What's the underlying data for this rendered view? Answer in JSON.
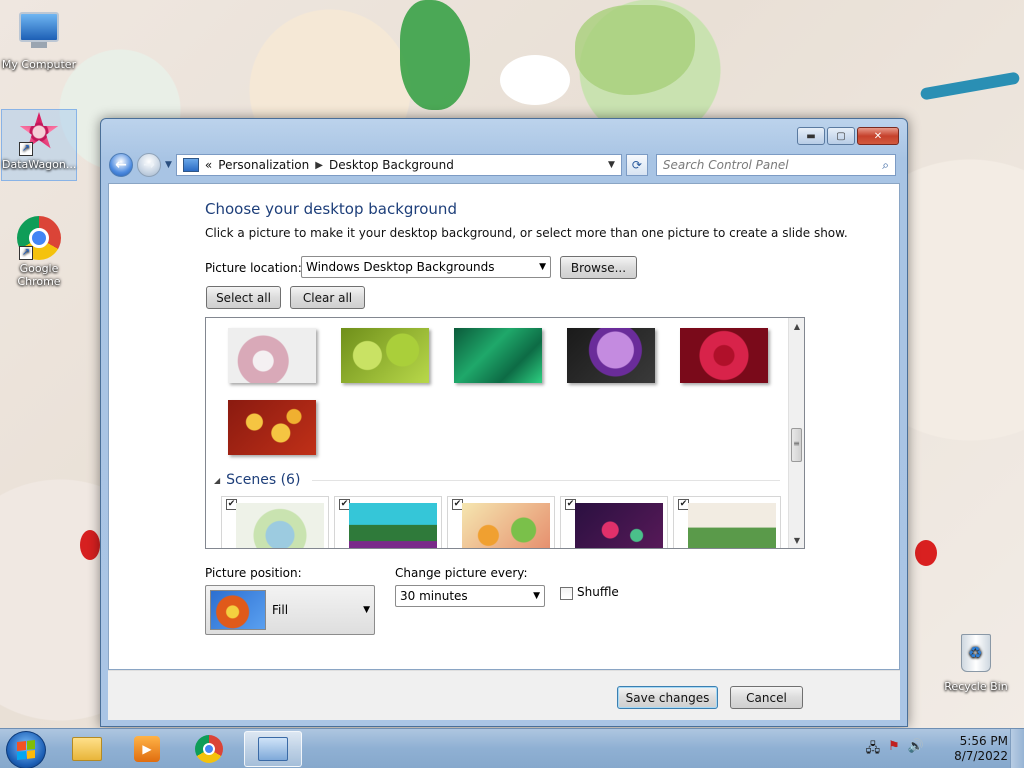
{
  "desktop": {
    "icons": [
      {
        "label": "My Computer"
      },
      {
        "label": "DataWagon..."
      },
      {
        "label": "Google Chrome"
      },
      {
        "label": "Recycle Bin"
      }
    ]
  },
  "window": {
    "breadcrumb": {
      "prefix": "«",
      "items": [
        "Personalization",
        "Desktop Background"
      ],
      "sep": "▶"
    },
    "search": {
      "placeholder": "Search Control Panel"
    },
    "heading": "Choose your desktop background",
    "description": "Click a picture to make it your desktop background, or select more than one picture to create a slide show.",
    "picture_location": {
      "label": "Picture location:",
      "value": "Windows Desktop Backgrounds",
      "browse_label": "Browse..."
    },
    "select_all_label": "Select all",
    "clear_all_label": "Clear all",
    "gallery": {
      "flowers_row1": 5,
      "flowers_row2": 1,
      "scenes_group": {
        "label": "Scenes (6)"
      },
      "scenes_checked": [
        true,
        true,
        true,
        true,
        true
      ]
    },
    "picture_position": {
      "label": "Picture position:",
      "value": "Fill"
    },
    "change_picture": {
      "label": "Change picture every:",
      "value": "30 minutes"
    },
    "shuffle": {
      "label": "Shuffle",
      "checked": false
    },
    "save_label": "Save changes",
    "cancel_label": "Cancel"
  },
  "taskbar": {
    "clock": {
      "time": "5:56 PM",
      "date": "8/7/2022"
    }
  },
  "colors": {
    "heading": "#1e3f7a",
    "taskbar": "#8fb0d3",
    "window_frame": "#aac5e5"
  }
}
